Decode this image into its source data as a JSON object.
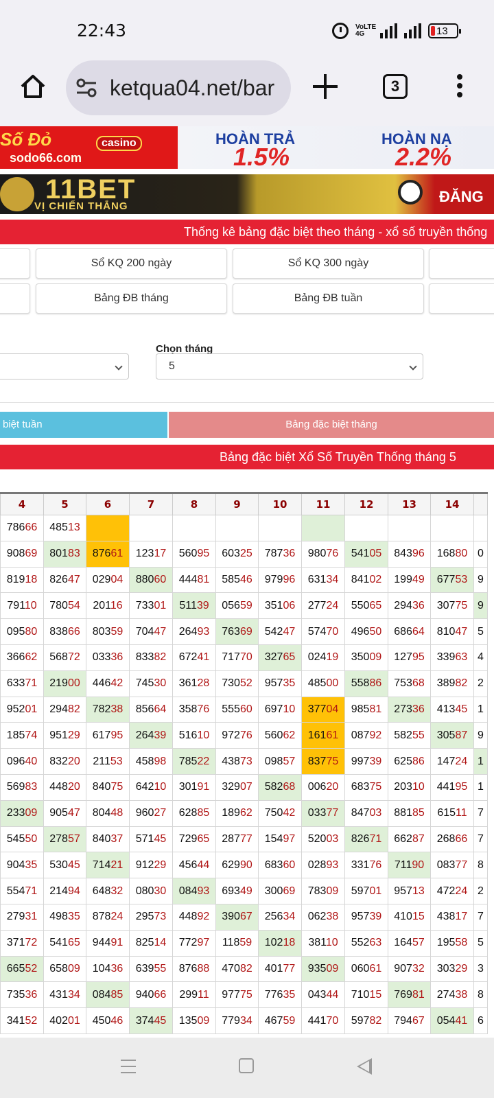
{
  "status": {
    "time": "22:43",
    "network": "VoLTE 4G",
    "battery": "13"
  },
  "browser": {
    "url": "ketqua04.net/bar",
    "tab_count": "3"
  },
  "banners": {
    "b1_brand": "Số Đỏ",
    "b1_casino": "casino",
    "b1_site": "sodo66.com",
    "b1_h1": "HOÀN TRẢ",
    "b1_p1": "1.5%",
    "b1_h2": "HOÀN NẠ",
    "b1_p2": "2.2%",
    "b2_brand": "11BET",
    "b2_sub": "VỊ CHIẾN THẮNG",
    "b2_cta": "ĐĂNG"
  },
  "page_title": "Thống kê bảng đặc biệt theo tháng - xổ số truyền thống",
  "buttons": {
    "row1": [
      "Sổ KQ 200 ngày",
      "Sổ KQ 300 ngày"
    ],
    "row2": [
      "Bảng ĐB tháng",
      "Bảng ĐB tuần"
    ]
  },
  "filters": {
    "month_label": "Chọn tháng",
    "month_value": "5"
  },
  "tabs": {
    "week": "biệt tuần",
    "month": "Bảng đặc biệt tháng"
  },
  "table_title": "Bảng đặc biệt Xổ Số Truyền Thống tháng 5",
  "table": {
    "headers": [
      "4",
      "5",
      "6",
      "7",
      "8",
      "9",
      "10",
      "11",
      "12",
      "13",
      "14",
      ""
    ],
    "rows": [
      [
        "78666",
        "48513",
        "",
        "",
        "",
        "",
        "",
        "",
        "",
        "",
        "",
        ""
      ],
      [
        "90869",
        "80183",
        "87661",
        "12317",
        "56095",
        "60325",
        "78736",
        "98076",
        "54105",
        "84396",
        "16880",
        "0"
      ],
      [
        "81918",
        "82647",
        "02904",
        "88060",
        "44481",
        "58546",
        "97996",
        "63134",
        "84102",
        "19949",
        "67753",
        "9"
      ],
      [
        "79110",
        "78054",
        "20116",
        "73301",
        "51139",
        "05659",
        "35106",
        "27724",
        "55065",
        "29436",
        "30775",
        "9"
      ],
      [
        "09580",
        "83866",
        "80359",
        "70447",
        "26493",
        "76369",
        "54247",
        "57470",
        "49650",
        "68664",
        "81047",
        "5"
      ],
      [
        "36662",
        "56872",
        "03336",
        "83382",
        "67241",
        "71770",
        "32765",
        "02419",
        "35009",
        "12795",
        "33963",
        "4"
      ],
      [
        "63371",
        "21900",
        "44642",
        "74530",
        "36128",
        "73052",
        "95735",
        "48500",
        "55886",
        "75368",
        "38982",
        "2"
      ],
      [
        "95201",
        "29482",
        "78238",
        "85664",
        "35876",
        "55560",
        "69710",
        "37704",
        "98581",
        "27336",
        "41345",
        "1"
      ],
      [
        "18574",
        "95129",
        "61795",
        "26439",
        "51610",
        "97276",
        "56062",
        "16161",
        "08792",
        "58255",
        "30587",
        "9"
      ],
      [
        "09640",
        "83220",
        "21153",
        "45898",
        "78522",
        "43873",
        "09857",
        "83775",
        "99739",
        "62586",
        "14724",
        "1"
      ],
      [
        "56983",
        "44820",
        "84075",
        "64210",
        "30191",
        "32907",
        "58268",
        "00620",
        "68375",
        "20310",
        "44195",
        "1"
      ],
      [
        "23309",
        "90547",
        "80448",
        "96027",
        "62885",
        "18962",
        "75042",
        "03377",
        "84703",
        "88185",
        "61511",
        "7"
      ],
      [
        "54550",
        "27857",
        "84037",
        "57145",
        "72965",
        "28777",
        "15497",
        "52003",
        "82671",
        "66287",
        "26866",
        "7"
      ],
      [
        "90435",
        "53045",
        "71421",
        "91229",
        "45644",
        "62990",
        "68360",
        "02893",
        "33176",
        "71190",
        "08377",
        "8"
      ],
      [
        "55471",
        "21494",
        "64832",
        "08030",
        "08493",
        "69349",
        "30069",
        "78309",
        "59701",
        "95713",
        "47224",
        "2"
      ],
      [
        "27931",
        "49835",
        "87824",
        "29573",
        "44892",
        "39067",
        "25634",
        "06238",
        "95739",
        "41015",
        "43817",
        "7"
      ],
      [
        "37172",
        "54165",
        "94491",
        "82514",
        "77297",
        "11859",
        "10218",
        "38110",
        "55263",
        "16457",
        "19558",
        "5"
      ],
      [
        "66552",
        "65809",
        "10436",
        "63955",
        "87688",
        "47082",
        "40177",
        "93509",
        "06061",
        "90732",
        "30329",
        "3"
      ],
      [
        "73536",
        "43134",
        "08485",
        "94066",
        "29911",
        "97775",
        "77635",
        "04344",
        "71015",
        "76981",
        "27438",
        "8"
      ],
      [
        "34152",
        "40201",
        "45046",
        "37445",
        "13509",
        "77934",
        "46759",
        "44170",
        "59782",
        "79467",
        "05441",
        "6"
      ]
    ],
    "highlight_green": [
      [
        0,
        7
      ],
      [
        1,
        1
      ],
      [
        1,
        8
      ],
      [
        2,
        3
      ],
      [
        2,
        10
      ],
      [
        3,
        4
      ],
      [
        3,
        11
      ],
      [
        4,
        5
      ],
      [
        5,
        6
      ],
      [
        6,
        1
      ],
      [
        6,
        8
      ],
      [
        7,
        2
      ],
      [
        7,
        9
      ],
      [
        8,
        3
      ],
      [
        8,
        10
      ],
      [
        9,
        4
      ],
      [
        9,
        11
      ],
      [
        10,
        6
      ],
      [
        11,
        0
      ],
      [
        11,
        7
      ],
      [
        12,
        1
      ],
      [
        12,
        8
      ],
      [
        13,
        2
      ],
      [
        13,
        9
      ],
      [
        14,
        4
      ],
      [
        15,
        5
      ],
      [
        16,
        6
      ],
      [
        17,
        0
      ],
      [
        17,
        7
      ],
      [
        18,
        2
      ],
      [
        18,
        9
      ],
      [
        19,
        3
      ],
      [
        19,
        10
      ]
    ],
    "highlight_yellow": [
      [
        0,
        2
      ],
      [
        1,
        2
      ],
      [
        7,
        7
      ],
      [
        8,
        7
      ],
      [
        9,
        7
      ]
    ]
  }
}
